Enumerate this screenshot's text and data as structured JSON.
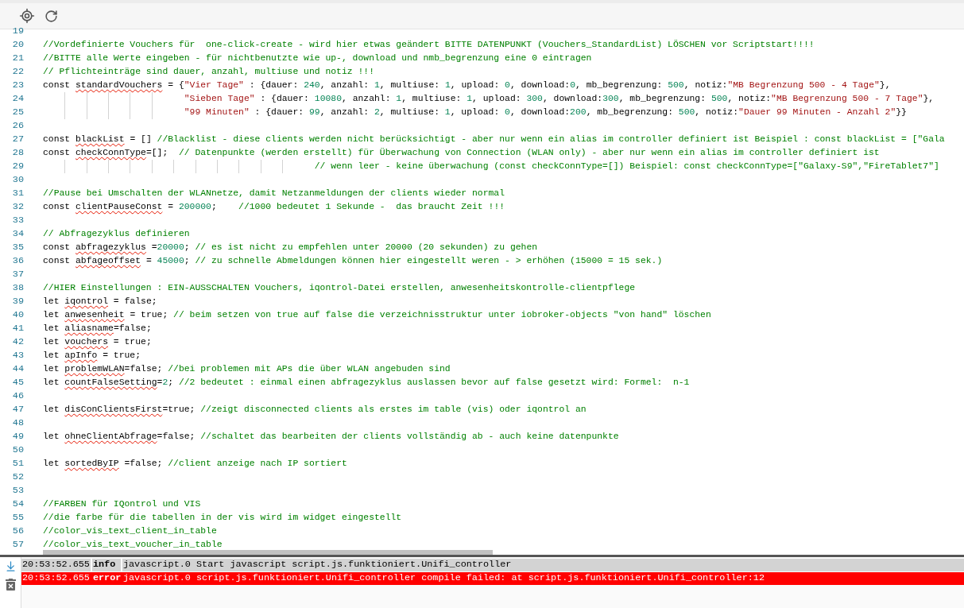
{
  "editor": {
    "lines": [
      {
        "number": "19"
      },
      {
        "number": "20",
        "tokens": [
          {
            "kind": "comment",
            "text": "//Vordefinierte Vouchers für  one-click-create - wird hier etwas geändert BITTE DATENPUNKT (Vouchers_StandardList) LÖSCHEN vor Scriptstart!!!!"
          }
        ]
      },
      {
        "number": "21",
        "tokens": [
          {
            "kind": "comment",
            "text": "//BITTE alle Werte eingeben - für nichtbenutzte wie up-, download und nmb_begrenzung eine 0 eintragen"
          }
        ]
      },
      {
        "number": "22",
        "tokens": [
          {
            "kind": "comment",
            "text": "// Pflichteinträge sind dauer, anzahl, multiuse und notiz !!!"
          }
        ]
      },
      {
        "number": "23",
        "tokens": [
          {
            "kind": "plain",
            "text": "const "
          },
          {
            "kind": "flagged",
            "text": "standardVouchers"
          },
          {
            "kind": "plain",
            "text": " = {"
          },
          {
            "kind": "string",
            "text": "\"Vier Tage\""
          },
          {
            "kind": "plain",
            "text": " : {dauer: "
          },
          {
            "kind": "number",
            "text": "240"
          },
          {
            "kind": "plain",
            "text": ", anzahl: "
          },
          {
            "kind": "number",
            "text": "1"
          },
          {
            "kind": "plain",
            "text": ", multiuse: "
          },
          {
            "kind": "number",
            "text": "1"
          },
          {
            "kind": "plain",
            "text": ", upload: "
          },
          {
            "kind": "number",
            "text": "0"
          },
          {
            "kind": "plain",
            "text": ", download:"
          },
          {
            "kind": "number",
            "text": "0"
          },
          {
            "kind": "plain",
            "text": ", mb_begrenzung: "
          },
          {
            "kind": "number",
            "text": "500"
          },
          {
            "kind": "plain",
            "text": ", notiz:"
          },
          {
            "kind": "string",
            "text": "\"MB Begrenzung 500 - 4 Tage\""
          },
          {
            "kind": "plain",
            "text": "},"
          }
        ]
      },
      {
        "number": "24",
        "tokens": [
          {
            "kind": "string",
            "text": "                          \"Sieben Tage\""
          },
          {
            "kind": "plain",
            "text": " : {dauer: "
          },
          {
            "kind": "number",
            "text": "10080"
          },
          {
            "kind": "plain",
            "text": ", anzahl: "
          },
          {
            "kind": "number",
            "text": "1"
          },
          {
            "kind": "plain",
            "text": ", multiuse: "
          },
          {
            "kind": "number",
            "text": "1"
          },
          {
            "kind": "plain",
            "text": ", upload: "
          },
          {
            "kind": "number",
            "text": "300"
          },
          {
            "kind": "plain",
            "text": ", download:"
          },
          {
            "kind": "number",
            "text": "300"
          },
          {
            "kind": "plain",
            "text": ", mb_begrenzung: "
          },
          {
            "kind": "number",
            "text": "500"
          },
          {
            "kind": "plain",
            "text": ", notiz:"
          },
          {
            "kind": "string",
            "text": "\"MB Begrenzung 500 - 7 Tage\""
          },
          {
            "kind": "plain",
            "text": "},"
          }
        ]
      },
      {
        "number": "25",
        "tokens": [
          {
            "kind": "string",
            "text": "                          \"99 Minuten\""
          },
          {
            "kind": "plain",
            "text": " : {dauer: "
          },
          {
            "kind": "number",
            "text": "99"
          },
          {
            "kind": "plain",
            "text": ", anzahl: "
          },
          {
            "kind": "number",
            "text": "2"
          },
          {
            "kind": "plain",
            "text": ", multiuse: "
          },
          {
            "kind": "number",
            "text": "1"
          },
          {
            "kind": "plain",
            "text": ", upload: "
          },
          {
            "kind": "number",
            "text": "0"
          },
          {
            "kind": "plain",
            "text": ", download:"
          },
          {
            "kind": "number",
            "text": "200"
          },
          {
            "kind": "plain",
            "text": ", mb_begrenzung: "
          },
          {
            "kind": "number",
            "text": "500"
          },
          {
            "kind": "plain",
            "text": ", notiz:"
          },
          {
            "kind": "string",
            "text": "\"Dauer 99 Minuten - Anzahl 2\""
          },
          {
            "kind": "plain",
            "text": "}}"
          }
        ]
      },
      {
        "number": "26"
      },
      {
        "number": "27",
        "tokens": [
          {
            "kind": "plain",
            "text": "const "
          },
          {
            "kind": "flagged",
            "text": "blackList"
          },
          {
            "kind": "plain",
            "text": " = [] "
          },
          {
            "kind": "comment",
            "text": "//Blacklist - diese clients werden nicht berücksichtigt - aber nur wenn ein alias im controller definiert ist Beispiel : const blackList = [\"Gala"
          }
        ]
      },
      {
        "number": "28",
        "tokens": [
          {
            "kind": "plain",
            "text": "const "
          },
          {
            "kind": "flagged",
            "text": "checkConnType"
          },
          {
            "kind": "plain",
            "text": "=[];  "
          },
          {
            "kind": "comment",
            "text": "// Datenpunkte (werden erstellt) für Überwachung von Connection (WLAN only) - aber nur wenn ein alias im controller definiert ist"
          }
        ]
      },
      {
        "number": "29",
        "tokens": [
          {
            "kind": "comment",
            "text": "                                                  // wenn leer - keine überwachung (const checkConnType=[]) Beispiel: const checkConnType=[\"Galaxy-S9\",\"FireTablet7\"]"
          }
        ]
      },
      {
        "number": "30"
      },
      {
        "number": "31",
        "tokens": [
          {
            "kind": "comment",
            "text": "//Pause bei Umschalten der WLANnetze, damit Netzanmeldungen der clients wieder normal"
          }
        ]
      },
      {
        "number": "32",
        "tokens": [
          {
            "kind": "plain",
            "text": "const "
          },
          {
            "kind": "flagged",
            "text": "clientPauseConst"
          },
          {
            "kind": "plain",
            "text": " = "
          },
          {
            "kind": "number",
            "text": "200000"
          },
          {
            "kind": "plain",
            "text": ";    "
          },
          {
            "kind": "comment",
            "text": "//1000 bedeutet 1 Sekunde -  das braucht Zeit !!!"
          }
        ]
      },
      {
        "number": "33"
      },
      {
        "number": "34",
        "tokens": [
          {
            "kind": "comment",
            "text": "// Abfragezyklus definieren"
          }
        ]
      },
      {
        "number": "35",
        "tokens": [
          {
            "kind": "plain",
            "text": "const "
          },
          {
            "kind": "flagged",
            "text": "abfragezyklus"
          },
          {
            "kind": "plain",
            "text": " ="
          },
          {
            "kind": "number",
            "text": "20000"
          },
          {
            "kind": "plain",
            "text": "; "
          },
          {
            "kind": "comment",
            "text": "// es ist nicht zu empfehlen unter 20000 (20 sekunden) zu gehen"
          }
        ]
      },
      {
        "number": "36",
        "tokens": [
          {
            "kind": "plain",
            "text": "const "
          },
          {
            "kind": "flagged",
            "text": "abfageoffset"
          },
          {
            "kind": "plain",
            "text": " = "
          },
          {
            "kind": "number",
            "text": "45000"
          },
          {
            "kind": "plain",
            "text": "; "
          },
          {
            "kind": "comment",
            "text": "// zu schnelle Abmeldungen können hier eingestellt weren - > erhöhen (15000 = 15 sek.)"
          }
        ]
      },
      {
        "number": "37"
      },
      {
        "number": "38",
        "tokens": [
          {
            "kind": "comment",
            "text": "//HIER Einstellungen : EIN-AUSSCHALTEN Vouchers, iqontrol-Datei erstellen, anwesenheitskontrolle-clientpflege"
          }
        ]
      },
      {
        "number": "39",
        "tokens": [
          {
            "kind": "plain",
            "text": "let "
          },
          {
            "kind": "flagged",
            "text": "iqontrol"
          },
          {
            "kind": "plain",
            "text": " = false;"
          }
        ]
      },
      {
        "number": "40",
        "tokens": [
          {
            "kind": "plain",
            "text": "let "
          },
          {
            "kind": "flagged",
            "text": "anwesenheit"
          },
          {
            "kind": "plain",
            "text": " = true; "
          },
          {
            "kind": "comment",
            "text": "// beim setzen von true auf false die verzeichnisstruktur unter iobroker-objects \"von hand\" löschen"
          }
        ]
      },
      {
        "number": "41",
        "tokens": [
          {
            "kind": "plain",
            "text": "let "
          },
          {
            "kind": "flagged",
            "text": "aliasname"
          },
          {
            "kind": "plain",
            "text": "=false;"
          }
        ]
      },
      {
        "number": "42",
        "tokens": [
          {
            "kind": "plain",
            "text": "let "
          },
          {
            "kind": "flagged",
            "text": "vouchers"
          },
          {
            "kind": "plain",
            "text": " = true;"
          }
        ]
      },
      {
        "number": "43",
        "tokens": [
          {
            "kind": "plain",
            "text": "let "
          },
          {
            "kind": "flagged",
            "text": "apInfo"
          },
          {
            "kind": "plain",
            "text": " = true;"
          }
        ]
      },
      {
        "number": "44",
        "tokens": [
          {
            "kind": "plain",
            "text": "let "
          },
          {
            "kind": "flagged",
            "text": "problemWLAN"
          },
          {
            "kind": "plain",
            "text": "=false; "
          },
          {
            "kind": "comment",
            "text": "//bei problemen mit APs die über WLAN angebuden sind"
          }
        ]
      },
      {
        "number": "45",
        "tokens": [
          {
            "kind": "plain",
            "text": "let "
          },
          {
            "kind": "flagged",
            "text": "countFalseSetting"
          },
          {
            "kind": "plain",
            "text": "="
          },
          {
            "kind": "number",
            "text": "2"
          },
          {
            "kind": "plain",
            "text": "; "
          },
          {
            "kind": "comment",
            "text": "//2 bedeutet : einmal einen abfragezyklus auslassen bevor auf false gesetzt wird: Formel:  n-1"
          }
        ]
      },
      {
        "number": "46"
      },
      {
        "number": "47",
        "tokens": [
          {
            "kind": "plain",
            "text": "let "
          },
          {
            "kind": "flagged",
            "text": "disConClientsFirst"
          },
          {
            "kind": "plain",
            "text": "=true; "
          },
          {
            "kind": "comment",
            "text": "//zeigt disconnected clients als erstes im table (vis) oder iqontrol an"
          }
        ]
      },
      {
        "number": "48"
      },
      {
        "number": "49",
        "tokens": [
          {
            "kind": "plain",
            "text": "let "
          },
          {
            "kind": "flagged",
            "text": "ohneClientAbfrage"
          },
          {
            "kind": "plain",
            "text": "=false; "
          },
          {
            "kind": "comment",
            "text": "//schaltet das bearbeiten der clients vollständig ab - auch keine datenpunkte"
          }
        ]
      },
      {
        "number": "50"
      },
      {
        "number": "51",
        "tokens": [
          {
            "kind": "plain",
            "text": "let "
          },
          {
            "kind": "flagged",
            "text": "sortedByIP"
          },
          {
            "kind": "plain",
            "text": " =false; "
          },
          {
            "kind": "comment",
            "text": "//client anzeige nach IP sortiert"
          }
        ]
      },
      {
        "number": "52"
      },
      {
        "number": "53"
      },
      {
        "number": "54",
        "tokens": [
          {
            "kind": "comment",
            "text": "//FARBEN für IQontrol und VIS"
          }
        ]
      },
      {
        "number": "55",
        "tokens": [
          {
            "kind": "comment",
            "text": "//die farbe für die tabellen in der vis wird im widget eingestellt"
          }
        ]
      },
      {
        "number": "56",
        "tokens": [
          {
            "kind": "comment",
            "text": "//color_vis_text_client_in_table"
          }
        ]
      },
      {
        "number": "57",
        "tokens": [
          {
            "kind": "comment",
            "text": "//color_vis_text_voucher_in_table"
          }
        ]
      }
    ]
  },
  "log": {
    "entries": [
      {
        "time": "20:53:52.655",
        "kind": "info",
        "severity": "info",
        "message": "javascript.0 Start javascript script.js.funktioniert.Unifi_controller"
      },
      {
        "time": "20:53:52.655",
        "kind": "error",
        "severity": "error",
        "message": "javascript.0 script.js.funktioniert.Unifi_controller compile failed: at script.js.funktioniert.Unifi_controller:12"
      }
    ]
  }
}
